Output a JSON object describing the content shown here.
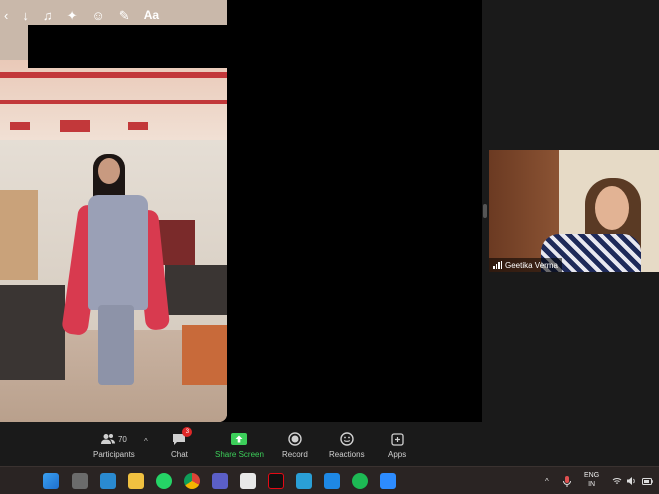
{
  "phone_toolbar": {
    "icons": [
      "back-chevron-icon",
      "download-icon",
      "music-note-icon",
      "sparkle-icon",
      "sticker-icon",
      "draw-icon"
    ],
    "text_label": "Aa"
  },
  "participant": {
    "name": "Geetika Verma"
  },
  "controls": {
    "participants_label": "Participants",
    "participants_count": "70",
    "chat_label": "Chat",
    "chat_badge": "3",
    "share_label": "Share Screen",
    "record_label": "Record",
    "reactions_label": "Reactions",
    "apps_label": "Apps"
  },
  "taskbar": {
    "apps": [
      "windows-start-icon",
      "task-view-icon",
      "desktop-icon",
      "file-explorer-icon",
      "whatsapp-icon",
      "chrome-icon",
      "teams-icon",
      "store-icon",
      "netflix-icon",
      "browser-icon",
      "l-app-icon",
      "spotify-icon",
      "zoom-icon"
    ],
    "lang_top": "ENG",
    "lang_bottom": "IN"
  },
  "colors": {
    "share_green": "#3ccf5a",
    "badge_red": "#e02828",
    "background": "#1a1a1a"
  }
}
